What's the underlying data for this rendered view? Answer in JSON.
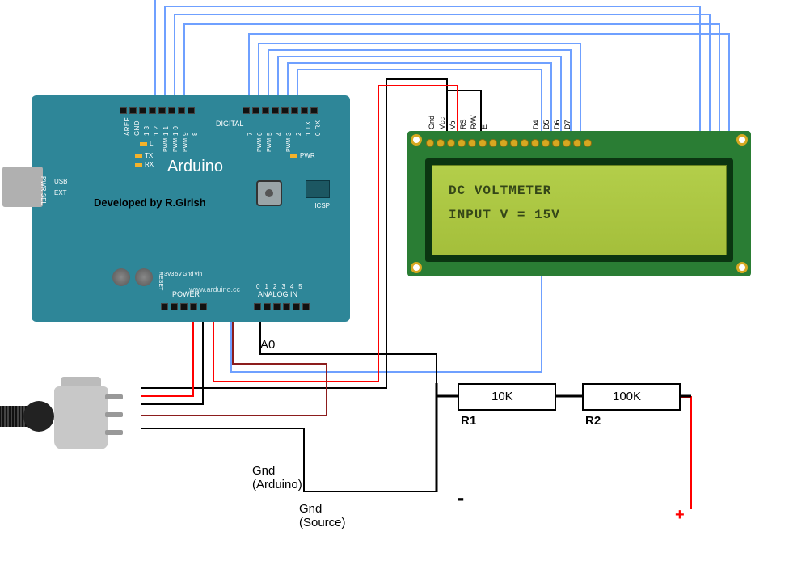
{
  "arduino": {
    "name": "Arduino",
    "developed_by": "Developed by R.Girish",
    "url": "www.arduino.cc",
    "digital": {
      "label": "DIGITAL",
      "pins": [
        "AREF",
        "GND",
        "1 3",
        "1 2",
        "1 1",
        "1 0",
        "9",
        "8"
      ],
      "pins2": [
        "7",
        "6",
        "5",
        "4",
        "3",
        "2",
        "1 TX",
        "0 RX"
      ]
    },
    "power": {
      "label": "POWER",
      "pins": [
        "RESET",
        "3V3",
        "5V",
        "Gnd",
        "Vin"
      ]
    },
    "analog": {
      "label": "ANALOG IN",
      "pins": [
        "0",
        "1",
        "2",
        "3",
        "4",
        "5"
      ]
    },
    "pwr_sel": "PWR SEL",
    "usb": "USB",
    "ext": "EXT",
    "icsp": "ICSP",
    "leds": {
      "l": "L",
      "tx": "TX",
      "rx": "RX",
      "pwr": "PWR"
    },
    "pwm": "PWM"
  },
  "lcd": {
    "line1": "DC VOLTMETER",
    "line2": "INPUT V  = 15V",
    "pins": [
      "Gnd",
      "Vcc",
      "Vo",
      "RS",
      "R/W",
      "E",
      "",
      "",
      "",
      "",
      "D4",
      "D5",
      "D6",
      "D7",
      "",
      ""
    ]
  },
  "r1": {
    "value": "10K",
    "name": "R1"
  },
  "r2": {
    "value": "100K",
    "name": "R2"
  },
  "labels": {
    "a0": "A0",
    "gnd_arduino_1": "Gnd",
    "gnd_arduino_2": "(Arduino)",
    "gnd_source_1": "Gnd",
    "gnd_source_2": "(Source)",
    "plus": "+",
    "minus": "-"
  }
}
